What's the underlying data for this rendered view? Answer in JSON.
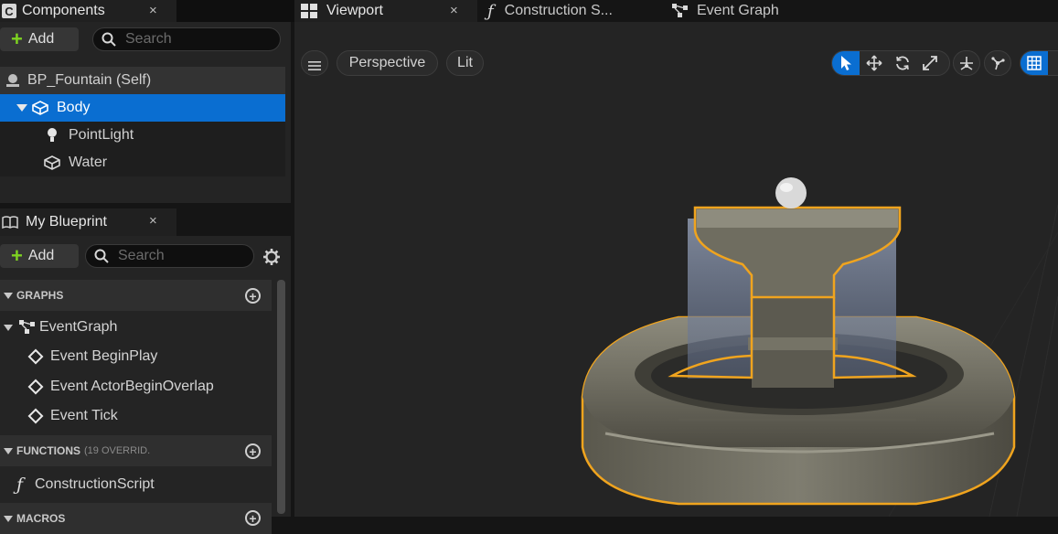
{
  "components_tab": {
    "title": "Components",
    "close": "×"
  },
  "components_toolbar": {
    "add_label": "Add",
    "search_placeholder": "Search"
  },
  "component_tree": [
    {
      "label": "BP_Fountain (Self)",
      "icon": "actor-icon"
    },
    {
      "label": "Body",
      "icon": "static-mesh-icon",
      "selected": true
    },
    {
      "label": "PointLight",
      "icon": "point-light-icon"
    },
    {
      "label": "Water",
      "icon": "static-mesh-icon"
    }
  ],
  "blueprint_tab": {
    "title": "My Blueprint",
    "close": "×"
  },
  "blueprint_toolbar": {
    "add_label": "Add",
    "search_placeholder": "Search"
  },
  "graphs": {
    "header": "GRAPHS",
    "event_graph": "EventGraph",
    "events": [
      "Event BeginPlay",
      "Event ActorBeginOverlap",
      "Event Tick"
    ]
  },
  "functions": {
    "header": "FUNCTIONS",
    "override_note": "(19 OVERRID.",
    "items": [
      "ConstructionScript"
    ]
  },
  "macros": {
    "header": "MACROS"
  },
  "editor_tabs": [
    {
      "label": "Viewport",
      "active": true,
      "close": "×"
    },
    {
      "label": "Construction S...",
      "active": false
    },
    {
      "label": "Event Graph",
      "active": false
    }
  ],
  "viewport_toolbar": {
    "perspective_label": "Perspective",
    "lit_label": "Lit",
    "tools": [
      "select-icon",
      "translate-icon",
      "rotate-icon",
      "scale-icon",
      "surface-snap-icon",
      "world-local-icon",
      "grid-snap-icon"
    ]
  },
  "colors": {
    "accent": "#0a6ed1",
    "selection_outline": "#f0a41e",
    "add_plus": "#7ed321"
  }
}
